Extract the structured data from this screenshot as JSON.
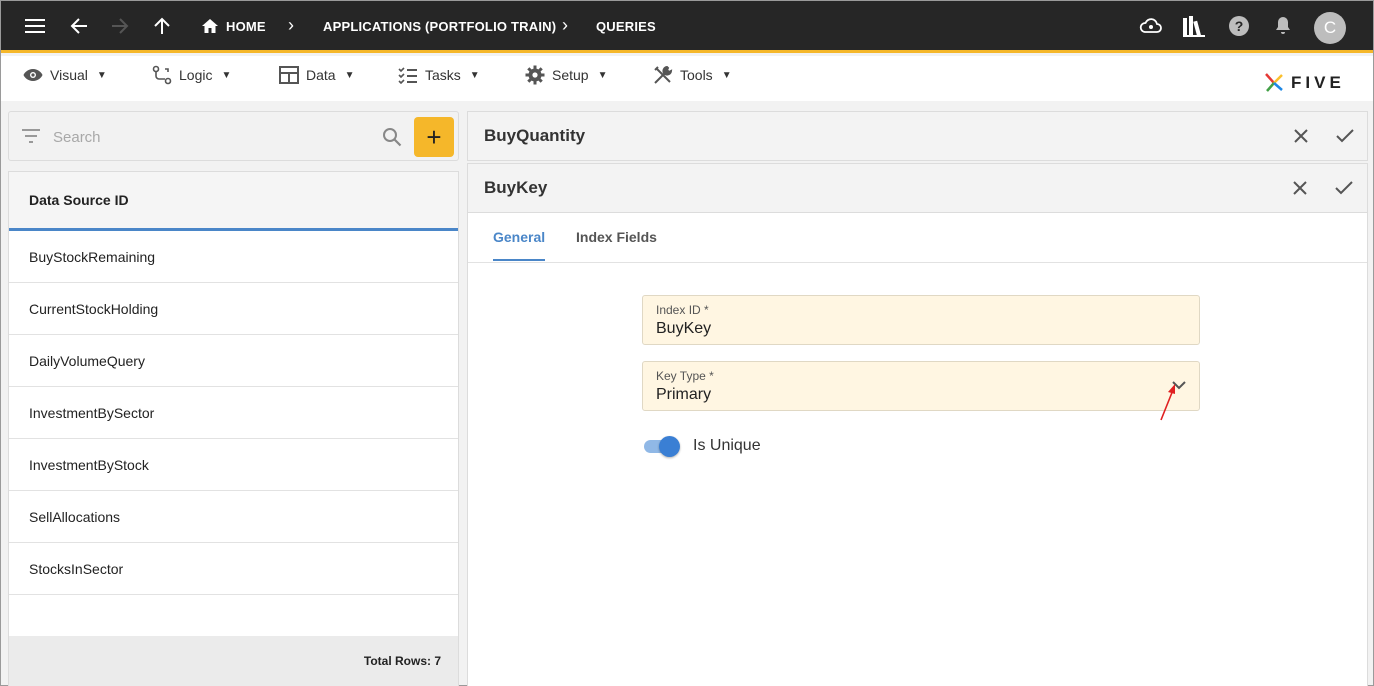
{
  "topbar": {
    "breadcrumbs": [
      "HOME",
      "APPLICATIONS (PORTFOLIO TRAIN)",
      "QUERIES"
    ],
    "avatar_initial": "C",
    "icons": [
      "menu-icon",
      "back-arrow-icon",
      "forward-arrow-icon",
      "up-arrow-icon",
      "home-icon",
      "cloud-settings-icon",
      "library-icon",
      "help-icon",
      "notifications-icon"
    ]
  },
  "menubar": {
    "items": [
      "Visual",
      "Logic",
      "Data",
      "Tasks",
      "Setup",
      "Tools"
    ],
    "logo_text": "FIVE"
  },
  "left_panel": {
    "search_placeholder": "Search",
    "add_label": "+",
    "column_header": "Data Source ID",
    "rows": [
      "BuyStockRemaining",
      "CurrentStockHolding",
      "DailyVolumeQuery",
      "InvestmentBySector",
      "InvestmentByStock",
      "SellAllocations",
      "StocksInSector"
    ],
    "total_rows": "Total Rows: 7"
  },
  "outer_form": {
    "title": "BuyQuantity"
  },
  "inner_form": {
    "title": "BuyKey",
    "tabs": [
      "General",
      "Index Fields"
    ],
    "fields": {
      "index_id": {
        "label": "Index ID *",
        "value": "BuyKey"
      },
      "key_type": {
        "label": "Key Type *",
        "value": "Primary"
      }
    },
    "is_unique": {
      "label": "Is Unique",
      "checked": true
    }
  },
  "colors": {
    "accent": "#f5b72a",
    "tab_active": "#4a86c8",
    "field_bg": "#fff6e2",
    "annotation_arrow": "#e02020"
  }
}
